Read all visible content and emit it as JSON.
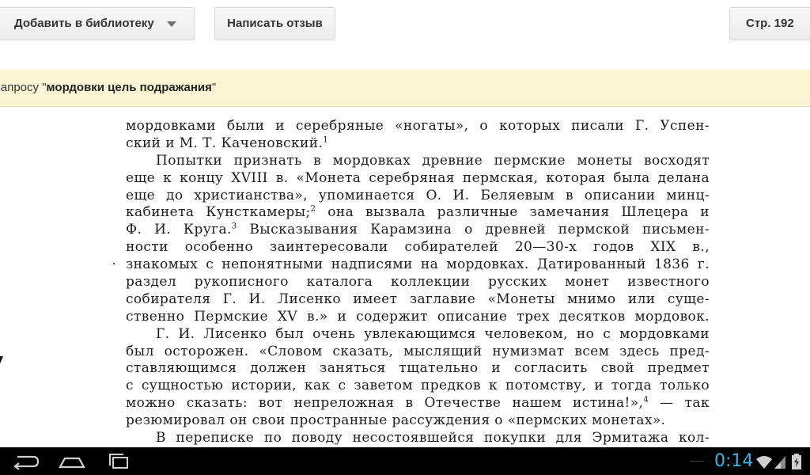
{
  "toolbar": {
    "add_to_library_label": "Добавить в библиотеку",
    "write_review_label": "Написать отзыв",
    "page_label": "Стр. 192"
  },
  "search_banner": {
    "prefix": "запросу \"",
    "query": "мордовки цель подражания",
    "suffix": "\""
  },
  "page_text": {
    "lines": [
      "мордовками были и серебряные «ногаты», о которых писали Г. Успен-",
      "ский и М. Т. Каченовский.",
      "Попытки признать в мордовках древние пермские монеты восходят",
      "еще к концу XVIII в. «Монета серебряная пермская, которая была делана",
      "еще до христианства», упоминается О. И. Беляевым в описании минц-",
      "кабинета Кунсткамеры;",
      "она вызвала различные замечания Шлецера и",
      "Ф. И. Круга.",
      "Высказывания Карамзина о древней пермской письмен-",
      "ности особенно заинтересовали собирателей 20—30-х годов XIX в.,",
      "знакомых с непонятными надписями на мордовках. Датированный 1836 г.",
      "раздел рукописного каталога коллекции русских монет известного",
      "собирателя Г. И. Лисенко имеет заглавие «Монеты мнимо или суще-",
      "ственно Пермские XV в.» и содержит описание трех десятков мордовок.",
      "Г. И. Лисенко был очень увлекающимся человеком, но с мордовками",
      "был осторожен. «Словом сказать, мыслящий нумизмат всем здесь пред-",
      "ставляющимся должен заняться тщательно и согласить свой предмет",
      "с сущностью истории, как с заветом предков к потомству, и тогда только",
      "можно сказать: вот непреложная в Отечестве нашем истина!»,",
      "— так",
      "резюмировал он свои пространные рассуждения о «пермских монетах».",
      "В переписке по поводу несостоявшейся покупки для Эрмитажа кол-"
    ],
    "footnote_marks": [
      "1",
      "2",
      "3",
      "4"
    ]
  },
  "status_bar": {
    "time": "0:14"
  },
  "icons": {
    "back": "back-icon",
    "home": "home-icon",
    "recents": "recent-apps-icon",
    "wifi": "wifi-icon",
    "signal": "signal-icon",
    "battery": "battery-icon"
  },
  "colors": {
    "banner_bg": "#fbf5d3",
    "clock": "#33b5e5",
    "navbar": "#000000"
  }
}
